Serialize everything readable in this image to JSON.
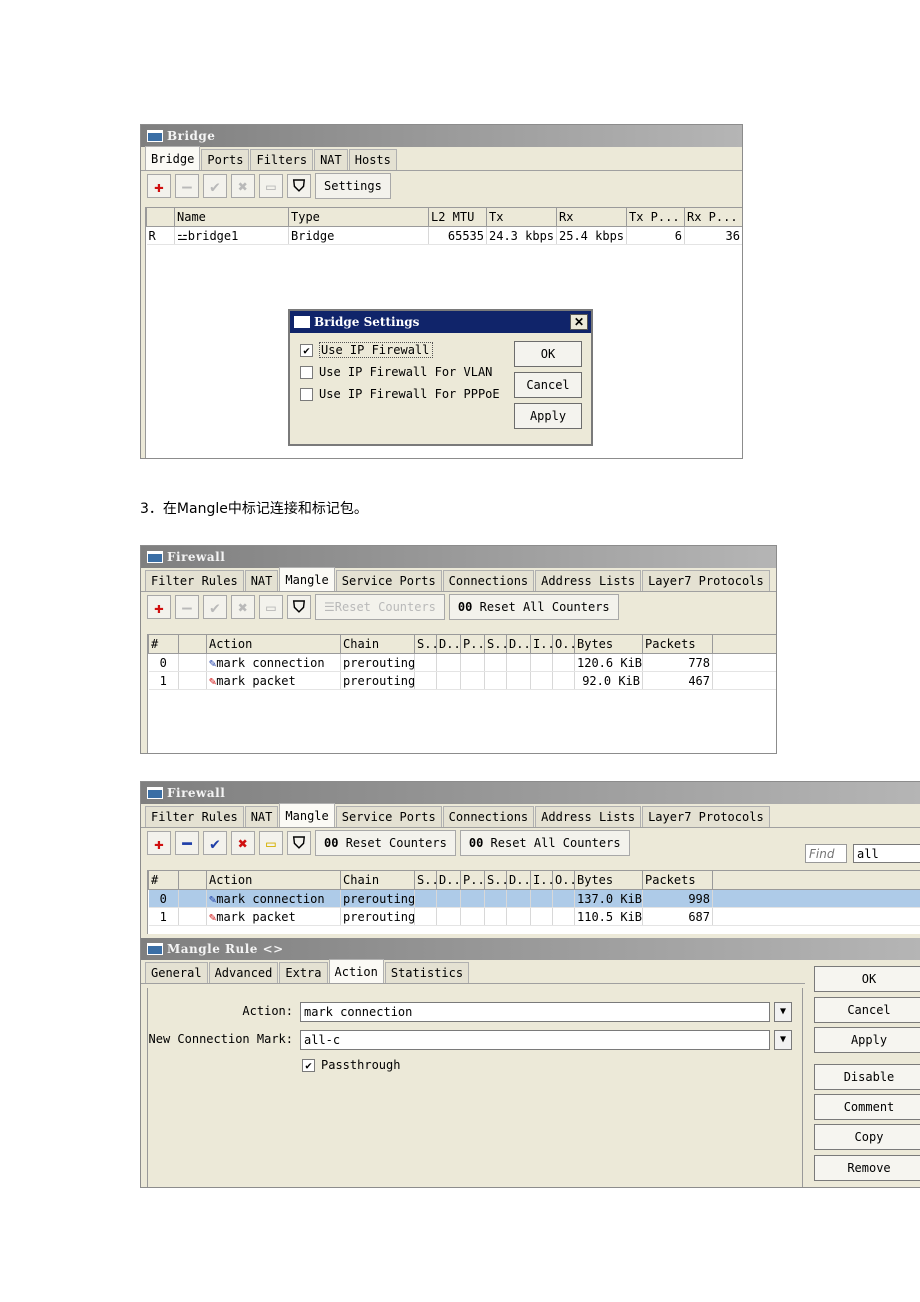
{
  "bridge_window": {
    "title": "Bridge",
    "tabs": [
      "Bridge",
      "Ports",
      "Filters",
      "NAT",
      "Hosts"
    ],
    "settings_label": "Settings",
    "columns": [
      "",
      "Name",
      "Type",
      "L2 MTU",
      "Tx",
      "Rx",
      "Tx P...",
      "Rx P..."
    ],
    "rows": [
      {
        "flag": "R",
        "name": "bridge1",
        "type": "Bridge",
        "l2mtu": "65535",
        "tx": "24.3 kbps",
        "rx": "25.4 kbps",
        "txp": "6",
        "rxp": "36"
      }
    ]
  },
  "bridge_settings": {
    "title": "Bridge Settings",
    "options": [
      {
        "label": "Use IP Firewall",
        "checked": true
      },
      {
        "label": "Use IP Firewall For VLAN",
        "checked": false
      },
      {
        "label": "Use IP Firewall For PPPoE",
        "checked": false
      }
    ],
    "ok": "OK",
    "cancel": "Cancel",
    "apply": "Apply"
  },
  "caption": "3．在Mangle中标记连接和标记包。",
  "firewall1": {
    "title": "Firewall",
    "tabs": [
      "Filter Rules",
      "NAT",
      "Mangle",
      "Service Ports",
      "Connections",
      "Address Lists",
      "Layer7 Protocols"
    ],
    "reset_counters": "Reset Counters",
    "reset_all_counters": "Reset All Counters",
    "columns": [
      "#",
      "",
      "Action",
      "Chain",
      "S..",
      "D..",
      "P..",
      "S..",
      "D..",
      "I..",
      "O..",
      "Bytes",
      "Packets"
    ],
    "rows": [
      {
        "n": "0",
        "action": "mark connection",
        "chain": "prerouting",
        "bytes": "120.6 KiB",
        "packets": "778"
      },
      {
        "n": "1",
        "action": "mark packet",
        "chain": "prerouting",
        "bytes": "92.0 KiB",
        "packets": "467"
      }
    ]
  },
  "firewall2": {
    "title": "Firewall",
    "tabs": [
      "Filter Rules",
      "NAT",
      "Mangle",
      "Service Ports",
      "Connections",
      "Address Lists",
      "Layer7 Protocols"
    ],
    "reset_counters": "Reset Counters",
    "reset_all_counters": "Reset All Counters",
    "find_placeholder": "Find",
    "filter_value": "all",
    "rows": [
      {
        "n": "0",
        "action": "mark connection",
        "chain": "prerouting",
        "bytes": "137.0 KiB",
        "packets": "998"
      },
      {
        "n": "1",
        "action": "mark packet",
        "chain": "prerouting",
        "bytes": "110.5 KiB",
        "packets": "687"
      }
    ]
  },
  "mangle_rule": {
    "title": "Mangle Rule <>",
    "tabs": [
      "General",
      "Advanced",
      "Extra",
      "Action",
      "Statistics"
    ],
    "action_label": "Action:",
    "action_value": "mark connection",
    "ncm_label": "New Connection Mark:",
    "ncm_value": "all-c",
    "passthrough_label": "Passthrough",
    "buttons": [
      "OK",
      "Cancel",
      "Apply",
      "Disable",
      "Comment",
      "Copy",
      "Remove"
    ]
  },
  "colors": {
    "selected_row": "#aecbe8",
    "dialog_title": "#10246a"
  }
}
